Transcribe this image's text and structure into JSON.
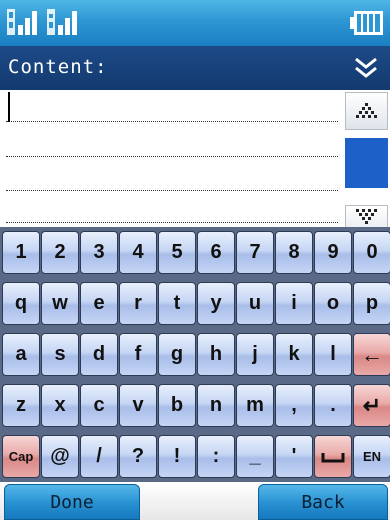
{
  "status": {
    "signal_icons": [
      "signal-strength-icon",
      "signal-strength-icon"
    ],
    "battery_icon": "battery-icon"
  },
  "header": {
    "title": "Content:",
    "chevron_icon": "double-chevron-down-icon"
  },
  "editor": {
    "text": "",
    "scroll_up_icon": "scroll-up-icon",
    "scroll_down_icon": "scroll-down-icon"
  },
  "keyboard": {
    "rows": [
      [
        "1",
        "2",
        "3",
        "4",
        "5",
        "6",
        "7",
        "8",
        "9",
        "0"
      ],
      [
        "q",
        "w",
        "e",
        "r",
        "t",
        "y",
        "u",
        "i",
        "o",
        "p"
      ],
      [
        "a",
        "s",
        "d",
        "f",
        "g",
        "h",
        "j",
        "k",
        "l",
        "←"
      ],
      [
        "z",
        "x",
        "c",
        "v",
        "b",
        "n",
        "m",
        ",",
        ".",
        "↵"
      ],
      [
        "Cap",
        "@",
        "/",
        "?",
        "!",
        ":",
        "_",
        "'",
        "space",
        "EN"
      ]
    ]
  },
  "softkeys": {
    "left": "Done",
    "right": "Back"
  },
  "colors": {
    "status_bar": "#2e97d3",
    "header": "#1d4a87",
    "key_blue": "#c6d6f4",
    "key_red": "#e9aaa8",
    "softkey": "#2a93d2"
  }
}
